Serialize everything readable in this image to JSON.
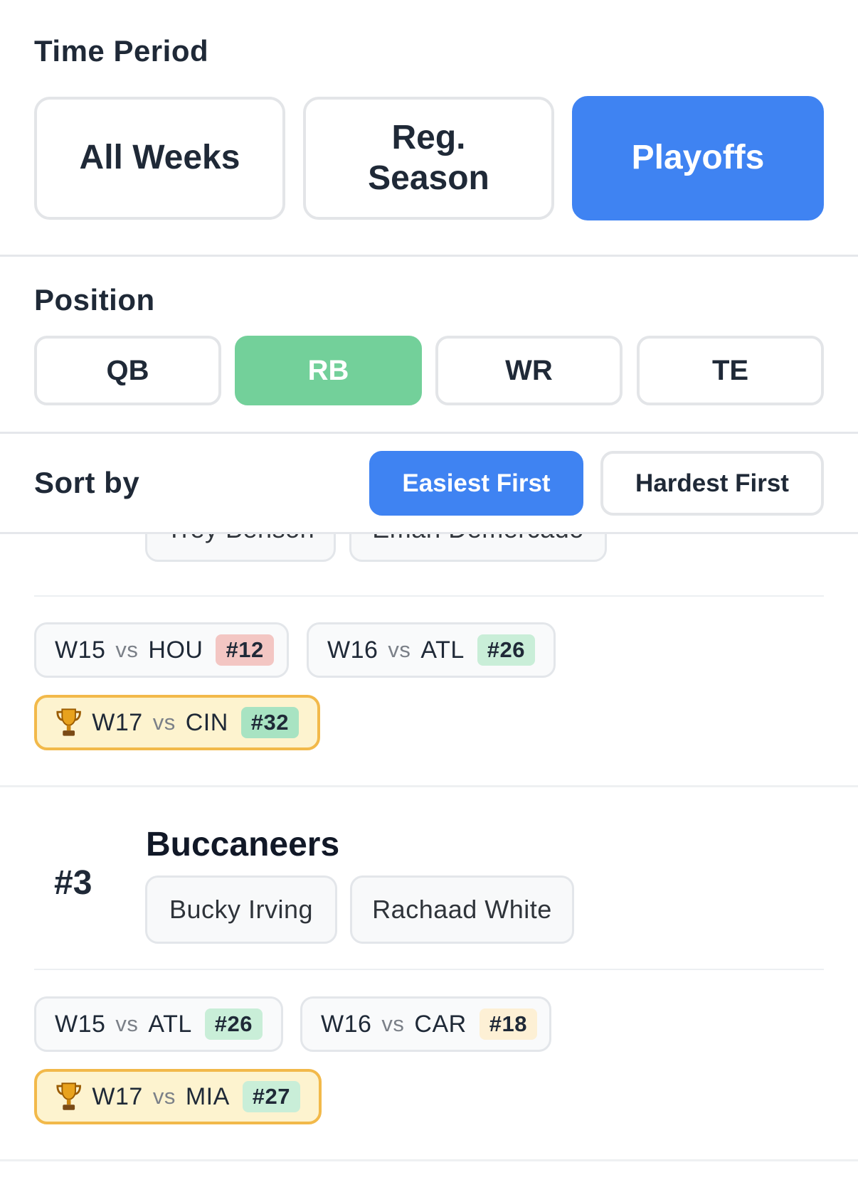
{
  "time_period": {
    "title": "Time Period",
    "options": [
      {
        "label_line1": "All Weeks",
        "label_line2": ""
      },
      {
        "label_line1": "Reg.",
        "label_line2": "Season"
      },
      {
        "label_line1": "Playoffs",
        "label_line2": ""
      }
    ],
    "selected": "Playoffs"
  },
  "position": {
    "title": "Position",
    "options": [
      "QB",
      "RB",
      "WR",
      "TE"
    ],
    "selected": "RB"
  },
  "sort": {
    "title": "Sort by",
    "options": [
      "Easiest First",
      "Hardest First"
    ],
    "selected": "Easiest First"
  },
  "colors": {
    "accent_blue": "#3f83f2",
    "accent_green": "#73d09a",
    "badge_red": "#f3c6c3",
    "badge_green": "#c9eed8",
    "badge_yellow": "#fdf0d5",
    "playoff_border": "#f2b94a",
    "playoff_bg": "#fdf3cf"
  },
  "teams": [
    {
      "rank": "",
      "name": "",
      "players": [
        "Trey Benson",
        "Emari Demercado"
      ],
      "games": [
        {
          "week": "W15",
          "vs": "vs",
          "opponent": "HOU",
          "badge": "#12",
          "badge_color": "red",
          "playoff": false
        },
        {
          "week": "W16",
          "vs": "vs",
          "opponent": "ATL",
          "badge": "#26",
          "badge_color": "green",
          "playoff": false
        },
        {
          "week": "W17",
          "vs": "vs",
          "opponent": "CIN",
          "badge": "#32",
          "badge_color": "green",
          "playoff": true,
          "icon": "trophy-icon"
        }
      ]
    },
    {
      "rank": "#3",
      "name": "Buccaneers",
      "players": [
        "Bucky Irving",
        "Rachaad White"
      ],
      "games": [
        {
          "week": "W15",
          "vs": "vs",
          "opponent": "ATL",
          "badge": "#26",
          "badge_color": "green",
          "playoff": false
        },
        {
          "week": "W16",
          "vs": "vs",
          "opponent": "CAR",
          "badge": "#18",
          "badge_color": "yellow",
          "playoff": false
        },
        {
          "week": "W17",
          "vs": "vs",
          "opponent": "MIA",
          "badge": "#27",
          "badge_color": "green",
          "playoff": true,
          "icon": "trophy-icon"
        }
      ]
    }
  ]
}
